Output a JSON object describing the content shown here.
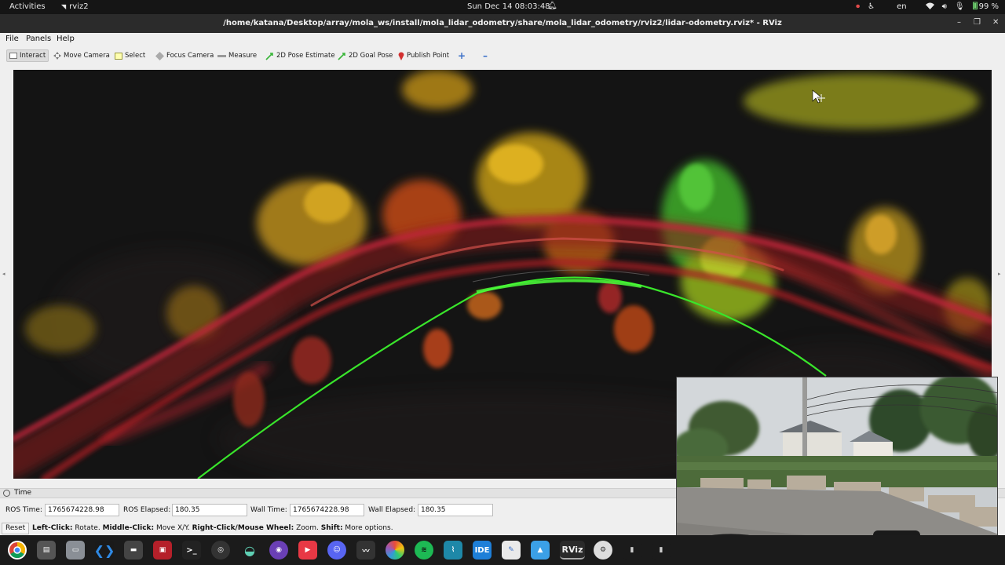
{
  "topbar": {
    "activities": "Activities",
    "app_name": "rviz2",
    "clock": "Sun Dec 14  08:03:48",
    "language": "en",
    "battery": "99 %"
  },
  "window": {
    "title": "/home/katana/Desktop/array/mola_ws/install/mola_lidar_odometry/share/mola_lidar_odometry/rviz2/lidar-odometry.rviz* - RViz"
  },
  "menu": [
    "File",
    "Panels",
    "Help"
  ],
  "toolbar": {
    "interact": "Interact",
    "move_camera": "Move Camera",
    "select": "Select",
    "focus_camera": "Focus Camera",
    "measure": "Measure",
    "pose_estimate": "2D Pose Estimate",
    "goal_pose": "2D Goal Pose",
    "publish_point": "Publish Point"
  },
  "time_panel": {
    "header": "Time",
    "ros_time_label": "ROS Time:",
    "ros_time": "1765674228.98",
    "ros_elapsed_label": "ROS Elapsed:",
    "ros_elapsed": "180.35",
    "wall_time_label": "Wall Time:",
    "wall_time": "1765674228.98",
    "wall_elapsed_label": "Wall Elapsed:",
    "wall_elapsed": "180.35",
    "reset": "Reset",
    "hint": {
      "left_click_key": "Left-Click:",
      "left_click_val": " Rotate. ",
      "middle_click_key": "Middle-Click:",
      "middle_click_val": " Move X/Y. ",
      "right_click_key": "Right-Click/Mouse Wheel:",
      "right_click_val": " Zoom. ",
      "shift_key": "Shift:",
      "shift_val": " More options."
    }
  },
  "dock": {
    "items": [
      "chrome",
      "files-cabinet",
      "files",
      "vscode",
      "terminal-red",
      "terminal",
      "obs",
      "mint",
      "github",
      "git-red",
      "discord",
      "monitor",
      "color-picker",
      "spotify",
      "plot",
      "ide",
      "text-editor",
      "mountain",
      "rviz",
      "settings",
      "usb-drive",
      "usb-drive-2"
    ],
    "ide_label": "IDE",
    "rviz_label": "RViz"
  },
  "colors": {
    "path": "#39e52b",
    "accent": "#e8e8e8"
  }
}
